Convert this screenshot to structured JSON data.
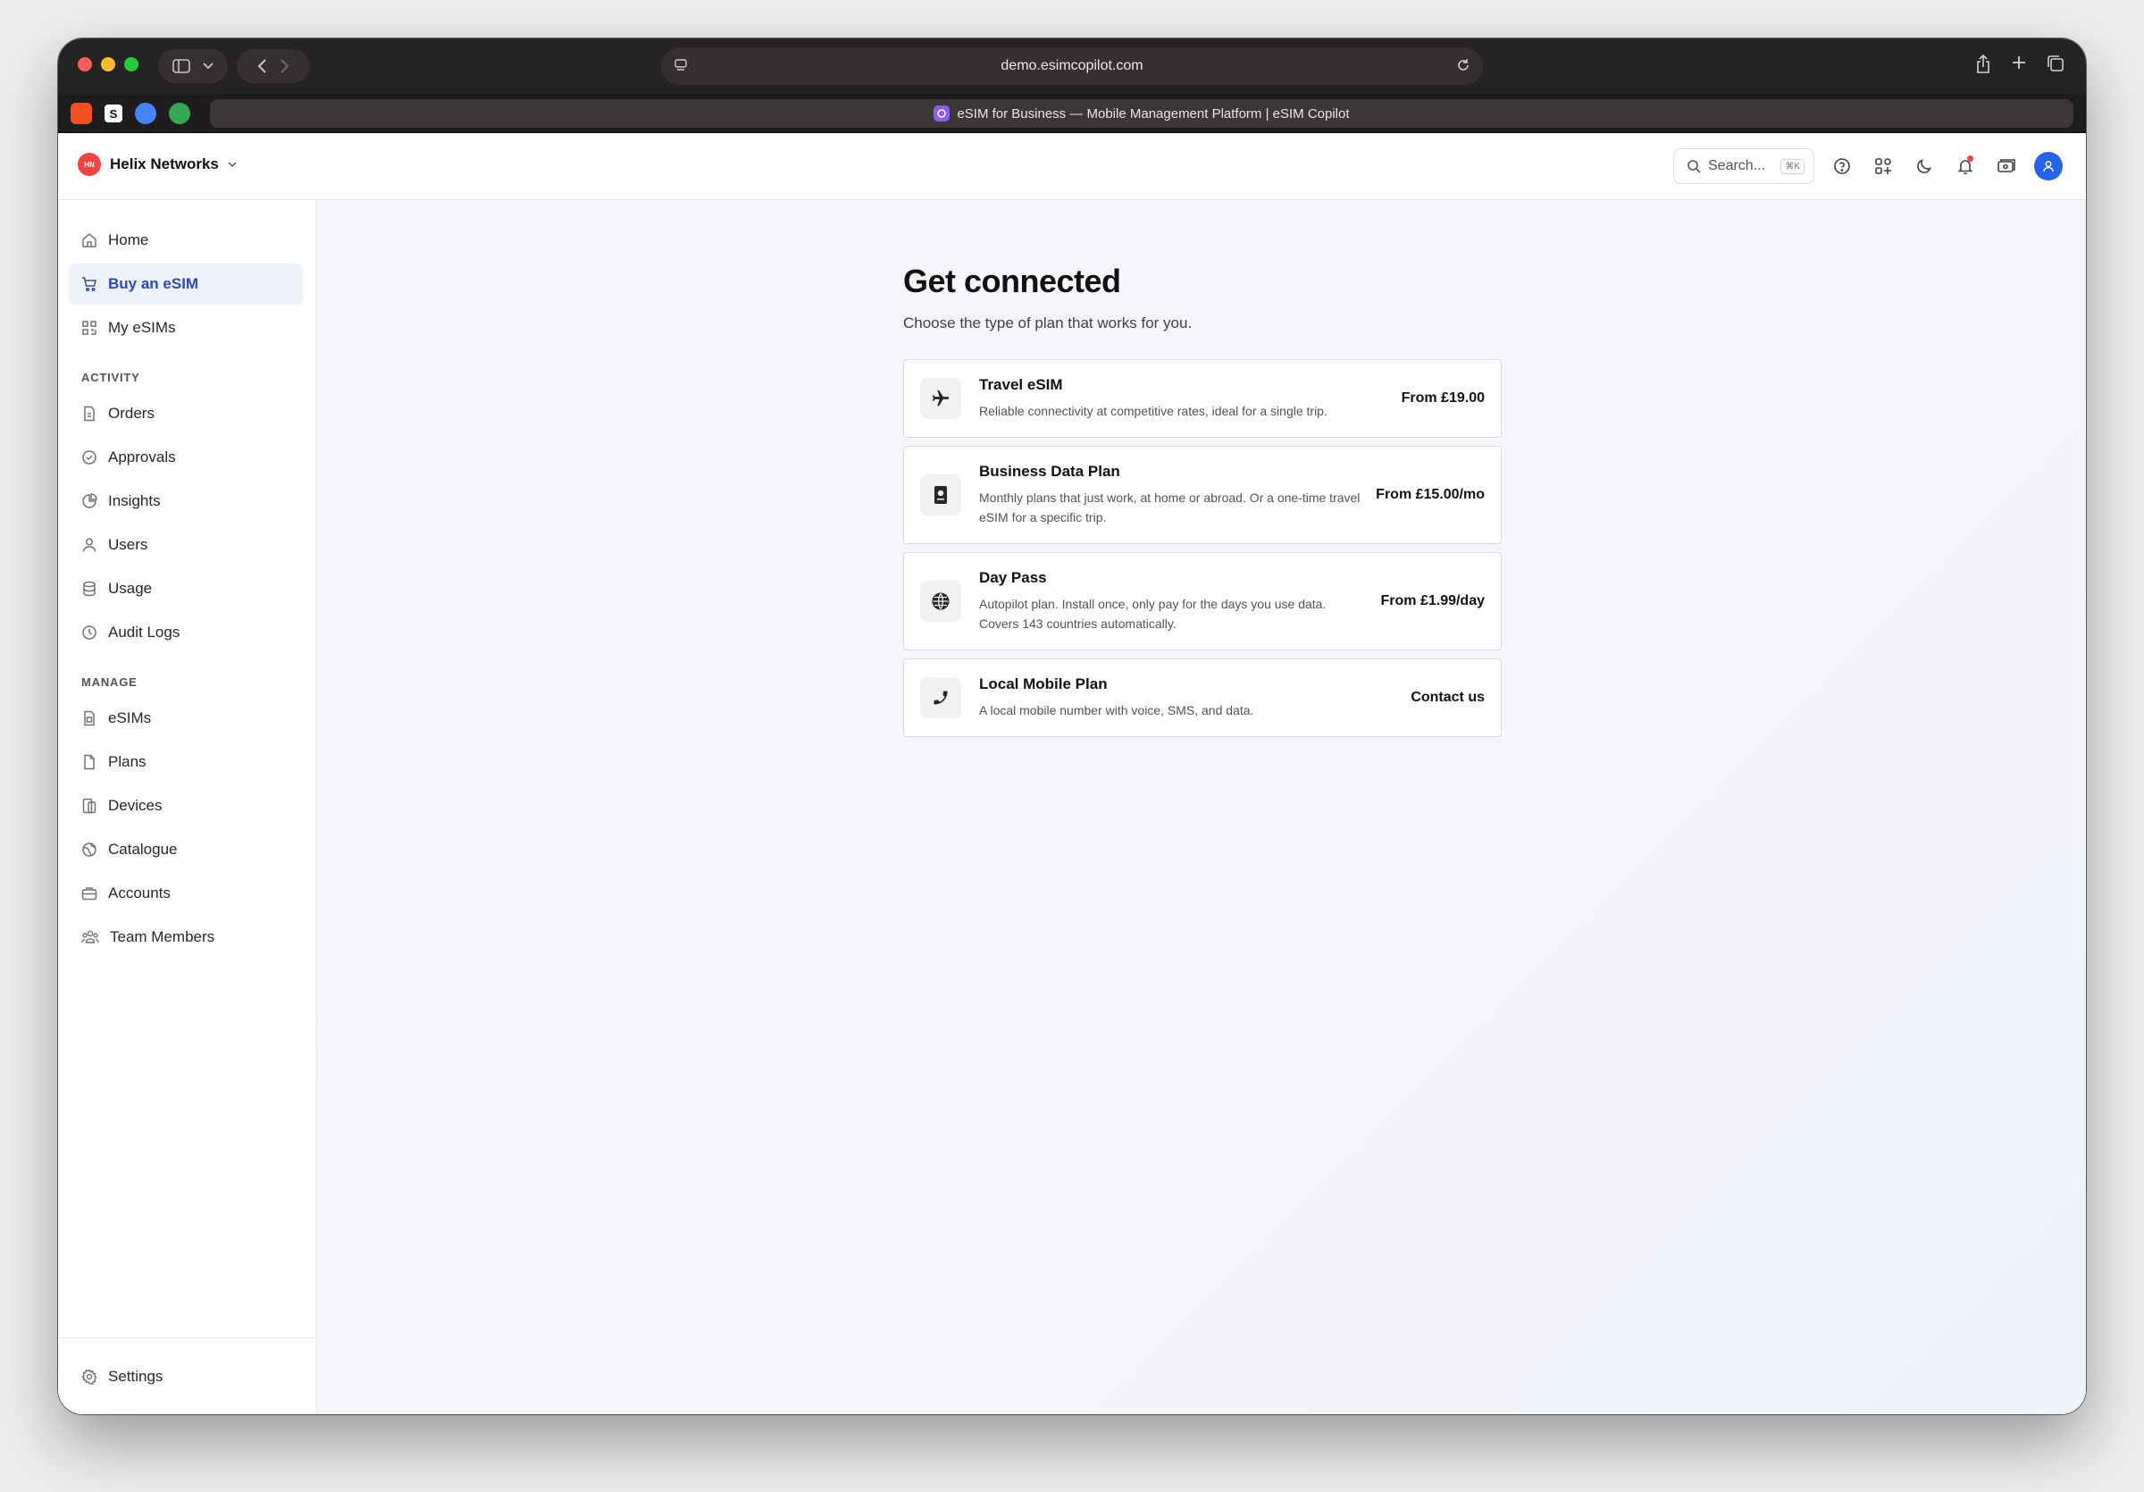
{
  "browser": {
    "url": "demo.esimcopilot.com",
    "tab_title": "eSIM for Business — Mobile Management Platform | eSIM Copilot",
    "pinned_tabs": [
      {
        "name": "pinned-tab-1",
        "glyph": ""
      },
      {
        "name": "pinned-tab-2",
        "glyph": "S"
      },
      {
        "name": "pinned-tab-3",
        "glyph": ""
      },
      {
        "name": "pinned-tab-4",
        "glyph": ""
      }
    ]
  },
  "header": {
    "workspace_initials": "HN",
    "workspace_name": "Helix Networks",
    "search_placeholder": "Search...",
    "search_shortcut": "⌘K"
  },
  "sidebar": {
    "primary": [
      {
        "label": "Home",
        "icon": "home-icon",
        "active": false
      },
      {
        "label": "Buy an eSIM",
        "icon": "cart-icon",
        "active": true
      },
      {
        "label": "My eSIMs",
        "icon": "qr-icon",
        "active": false
      }
    ],
    "activity_label": "ACTIVITY",
    "activity": [
      {
        "label": "Orders",
        "icon": "document-icon"
      },
      {
        "label": "Approvals",
        "icon": "check-circle-icon"
      },
      {
        "label": "Insights",
        "icon": "pie-chart-icon"
      },
      {
        "label": "Users",
        "icon": "user-icon"
      },
      {
        "label": "Usage",
        "icon": "database-icon"
      },
      {
        "label": "Audit Logs",
        "icon": "clock-icon"
      }
    ],
    "manage_label": "MANAGE",
    "manage": [
      {
        "label": "eSIMs",
        "icon": "sim-icon"
      },
      {
        "label": "Plans",
        "icon": "file-icon"
      },
      {
        "label": "Devices",
        "icon": "device-icon"
      },
      {
        "label": "Catalogue",
        "icon": "globe-icon"
      },
      {
        "label": "Accounts",
        "icon": "briefcase-icon"
      },
      {
        "label": "Team Members",
        "icon": "team-icon"
      }
    ],
    "settings_label": "Settings"
  },
  "main": {
    "title": "Get connected",
    "subtitle": "Choose the type of plan that works for you.",
    "plans": [
      {
        "title": "Travel eSIM",
        "description": "Reliable connectivity at competitive rates, ideal for a single trip.",
        "price": "From £19.00",
        "icon": "plane-icon"
      },
      {
        "title": "Business Data Plan",
        "description": "Monthly plans that just work, at home or abroad. Or a one-time travel eSIM for a specific trip.",
        "price": "From £15.00/mo",
        "icon": "passport-icon"
      },
      {
        "title": "Day Pass",
        "description": "Autopilot plan. Install once, only pay for the days you use data. Covers 143 countries automatically.",
        "price": "From £1.99/day",
        "icon": "globe-icon"
      },
      {
        "title": "Local Mobile Plan",
        "description": "A local mobile number with voice, SMS, and data.",
        "price": "Contact us",
        "icon": "phone-icon"
      }
    ]
  }
}
